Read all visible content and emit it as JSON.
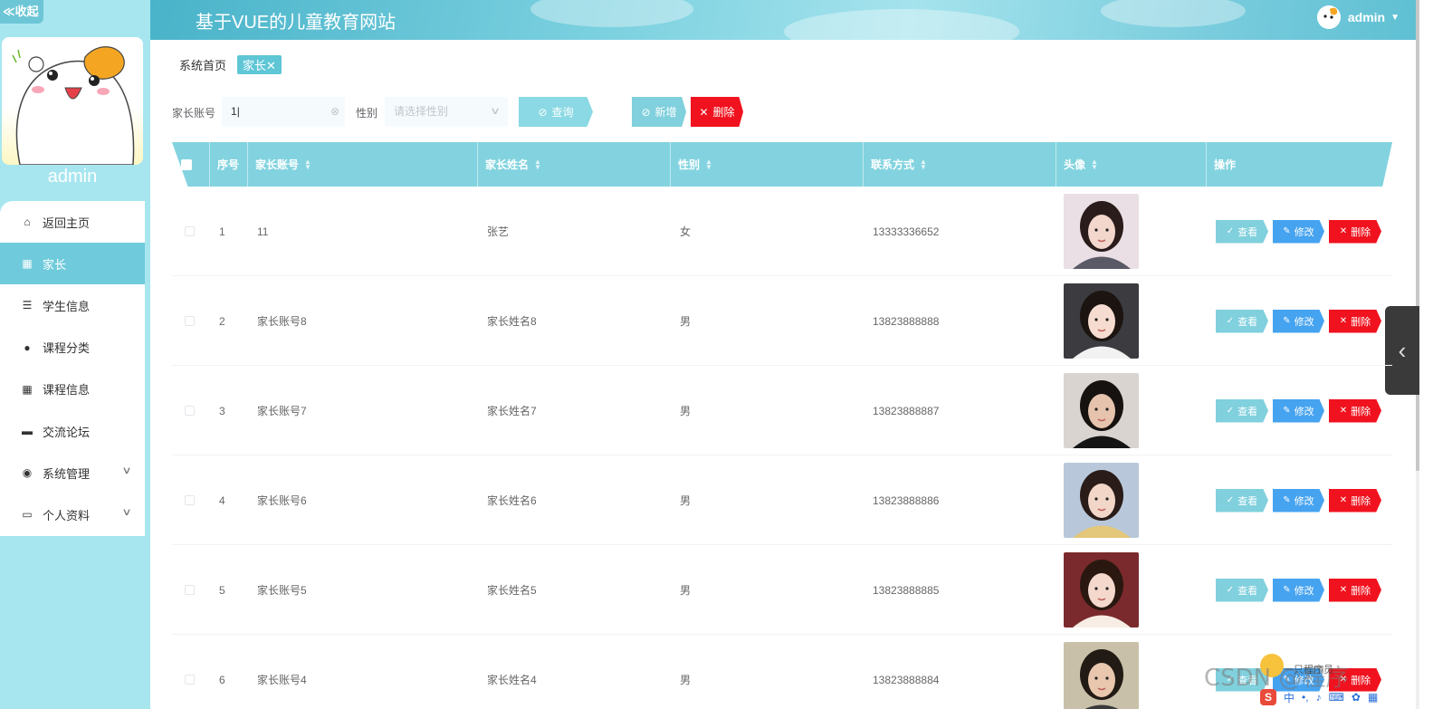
{
  "sidebar": {
    "collapse_label": "≪收起",
    "username": "admin",
    "menu": [
      {
        "label": "返回主页",
        "icon": "home-icon",
        "glyph": "⌂",
        "active": false,
        "expandable": false
      },
      {
        "label": "家长",
        "icon": "grid-icon",
        "glyph": "▦",
        "active": true,
        "expandable": false
      },
      {
        "label": "学生信息",
        "icon": "list-icon",
        "glyph": "☰",
        "active": false,
        "expandable": false
      },
      {
        "label": "课程分类",
        "icon": "user-icon",
        "glyph": "●",
        "active": false,
        "expandable": false
      },
      {
        "label": "课程信息",
        "icon": "grid-icon",
        "glyph": "▦",
        "active": false,
        "expandable": false
      },
      {
        "label": "交流论坛",
        "icon": "chat-icon",
        "glyph": "▬",
        "active": false,
        "expandable": false
      },
      {
        "label": "系统管理",
        "icon": "bulb-icon",
        "glyph": "◉",
        "active": false,
        "expandable": true
      },
      {
        "label": "个人资料",
        "icon": "card-icon",
        "glyph": "▭",
        "active": false,
        "expandable": true
      }
    ]
  },
  "header": {
    "title": "基于VUE的儿童教育网站",
    "username": "admin"
  },
  "breadcrumb": {
    "home": "系统首页",
    "current_tag": "家长✕"
  },
  "search": {
    "account_label": "家长账号",
    "account_value": "1",
    "gender_label": "性别",
    "gender_placeholder": "请选择性别",
    "search_button": "查询",
    "add_button": "新增",
    "delete_button": "删除"
  },
  "table": {
    "columns": [
      "",
      "序号",
      "家长账号",
      "家长姓名",
      "性别",
      "联系方式",
      "头像",
      "操作"
    ],
    "row_actions": {
      "view": "查看",
      "edit": "修改",
      "delete": "删除"
    },
    "rows": [
      {
        "index": "1",
        "account": "11",
        "name": "张艺",
        "gender": "女",
        "phone": "13333336652"
      },
      {
        "index": "2",
        "account": "家长账号8",
        "name": "家长姓名8",
        "gender": "男",
        "phone": "13823888888"
      },
      {
        "index": "3",
        "account": "家长账号7",
        "name": "家长姓名7",
        "gender": "男",
        "phone": "13823888887"
      },
      {
        "index": "4",
        "account": "家长账号6",
        "name": "家长姓名6",
        "gender": "男",
        "phone": "13823888886"
      },
      {
        "index": "5",
        "account": "家长账号5",
        "name": "家长姓名5",
        "gender": "男",
        "phone": "13823888885"
      },
      {
        "index": "6",
        "account": "家长账号4",
        "name": "家长姓名4",
        "gender": "男",
        "phone": "13823888884"
      }
    ]
  },
  "watermark": {
    "text": "CSDN @程序",
    "small_text": "一只程序员"
  },
  "colors": {
    "sidebar_bg": "#a7e6ef",
    "accent": "#6fcbdb",
    "table_header": "#82d3df",
    "edit_button": "#46a3f0",
    "delete_button": "#f0121e"
  }
}
